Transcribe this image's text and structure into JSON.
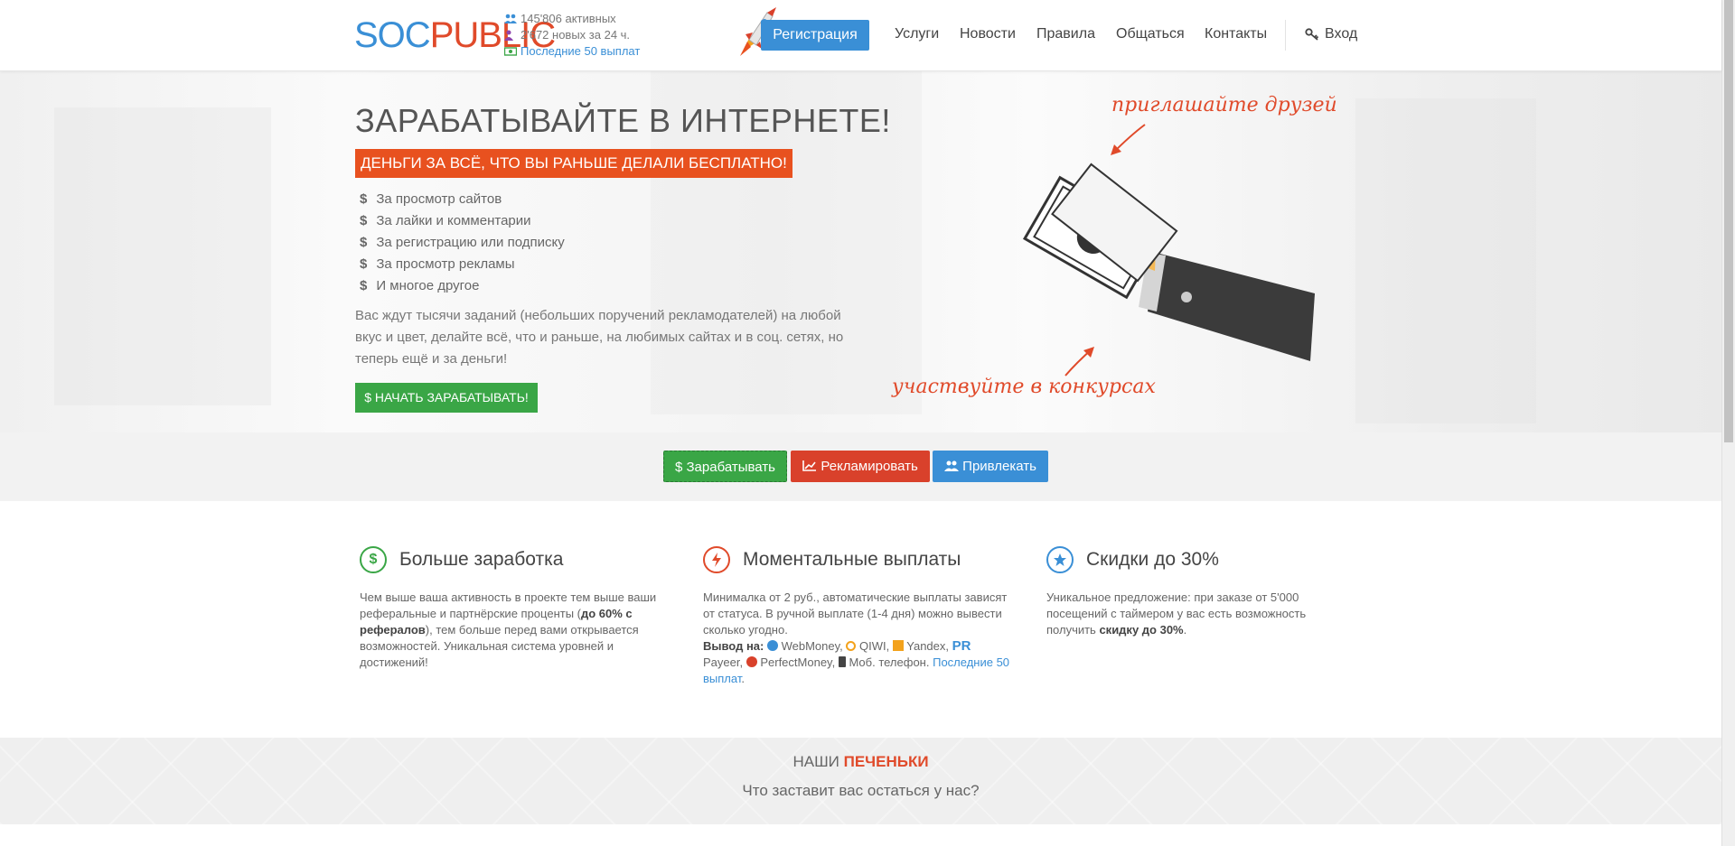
{
  "header": {
    "logo_soc": "SOC",
    "logo_public": "PUBLIC",
    "stats": {
      "active": "145'806 активных",
      "new24": "2'672 новых за 24 ч.",
      "payouts_link": "Последние 50 выплат"
    },
    "register_label": "Регистрация",
    "nav": [
      "Услуги",
      "Новости",
      "Правила",
      "Общаться",
      "Контакты"
    ],
    "login_label": "Вход"
  },
  "hero": {
    "title": "ЗАРАБАТЫВАЙТЕ В ИНТЕРНЕТЕ!",
    "banner": "ДЕНЬГИ ЗА ВСЁ, ЧТО ВЫ РАНЬШЕ ДЕЛАЛИ БЕСПЛАТНО!",
    "list": [
      "За просмотр сайтов",
      "За лайки и комментарии",
      "За регистрацию или подписку",
      "За просмотр рекламы",
      "И многое другое"
    ],
    "description": "Вас ждут тысячи заданий (небольших поручений рекламодателей) на любой вкус и цвет, делайте всё, что и раньше, на любимых сайтах и в соц. сетях, но теперь ещё и за деньги!",
    "start_button": "$ НАЧАТЬ ЗАРАБАТЫВАТЬ!",
    "invite_text": "приглашайте друзей",
    "contests_text": "участвуйте в конкурсах"
  },
  "tabs": {
    "earn": "$ Зарабатывать",
    "advertise": "Рекламировать",
    "attract": "Привлекать"
  },
  "features": [
    {
      "title": "Больше заработка",
      "text_a": "Чем выше ваша активность в проекте тем выше ваши реферальные и партнёрские проценты (",
      "text_b": "до 60% с рефералов",
      "text_c": "), тем больше перед вами открывается возможностей. Уникальная система уровней и достижений!"
    },
    {
      "title": "Моментальные выплаты",
      "text_a": "Минималка от 2 руб., автоматические выплаты зависят от статуса. В ручной выплате (1-4 дня) можно вывести сколько угодно.",
      "payout_label": "Вывод на:",
      "systems": [
        "WebMoney,",
        "QIWI,",
        "Yandex,",
        "Payeer,",
        "PerfectMoney,",
        "Моб. телефон."
      ],
      "link": "Последние 50 выплат",
      "dot": "."
    },
    {
      "title": "Скидки до 30%",
      "text_a": "Уникальное предложение: при заказе от 5'000 посещений с таймером у вас есть возможность получить ",
      "text_b": "скидку до 30%",
      "text_c": "."
    }
  ],
  "cookies": {
    "title_a": "НАШИ",
    "title_b": "ПЕЧЕНЬКИ",
    "subtitle": "Что заставит вас остаться у нас?"
  },
  "colors": {
    "blue": "#3a8fd6",
    "red": "#e04a2a",
    "green": "#3aa646"
  }
}
